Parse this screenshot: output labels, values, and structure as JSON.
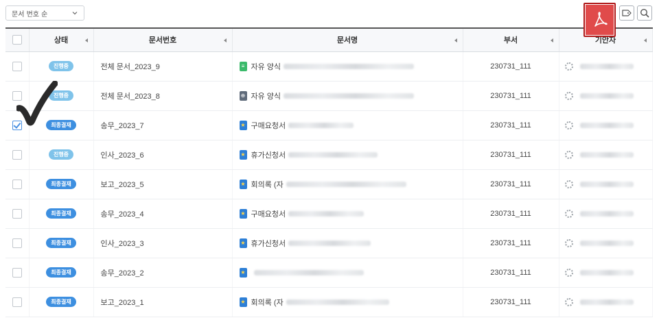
{
  "toolbar": {
    "sort_label": "문서 번호 순",
    "pdf_icon": "pdf-icon",
    "tag_icon": "tag-icon",
    "search_icon": "search-icon"
  },
  "columns": {
    "status": "상태",
    "doc_no": "문서번호",
    "doc_name": "문서명",
    "dept": "부서",
    "drafter": "기안자"
  },
  "status_colors": {
    "진행중": "#7fc3ea",
    "최종결재": "#3d8fe0"
  },
  "rows": [
    {
      "checked": false,
      "status": "진행중",
      "doc_no": "전체 문서_2023_9",
      "icon": "green",
      "doc_label": "자유 양식",
      "dept": "230731_111"
    },
    {
      "checked": false,
      "status": "진행중",
      "doc_no": "전체 문서_2023_8",
      "icon": "gray",
      "doc_label": "자유 양식",
      "dept": "230731_111"
    },
    {
      "checked": true,
      "status": "최종결재",
      "doc_no": "송무_2023_7",
      "icon": "blue",
      "doc_label": "구매요청서",
      "dept": "230731_111"
    },
    {
      "checked": false,
      "status": "진행중",
      "doc_no": "인사_2023_6",
      "icon": "blue",
      "doc_label": "휴가신청서",
      "dept": "230731_111"
    },
    {
      "checked": false,
      "status": "최종결재",
      "doc_no": "보고_2023_5",
      "icon": "blue",
      "doc_label": "회의록 (자",
      "dept": "230731_111"
    },
    {
      "checked": false,
      "status": "최종결재",
      "doc_no": "송무_2023_4",
      "icon": "blue",
      "doc_label": "구매요청서",
      "dept": "230731_111"
    },
    {
      "checked": false,
      "status": "최종결재",
      "doc_no": "인사_2023_3",
      "icon": "blue",
      "doc_label": "휴가신청서",
      "dept": "230731_111"
    },
    {
      "checked": false,
      "status": "최종결재",
      "doc_no": "송무_2023_2",
      "icon": "blue",
      "doc_label": "",
      "dept": "230731_111"
    },
    {
      "checked": false,
      "status": "최종결재",
      "doc_no": "보고_2023_1",
      "icon": "blue",
      "doc_label": "회의록 (자",
      "dept": "230731_111"
    }
  ]
}
